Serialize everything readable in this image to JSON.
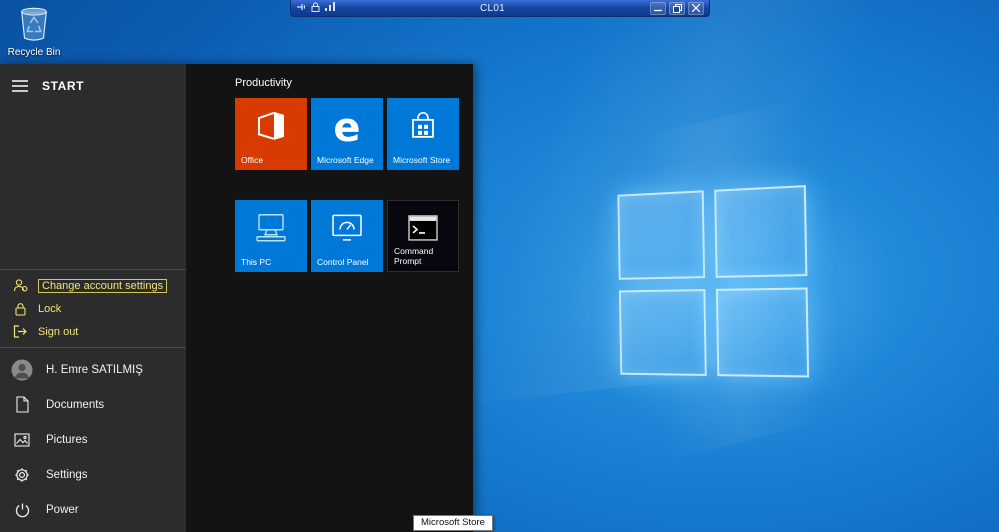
{
  "connection_bar": {
    "title": "CL01"
  },
  "desktop": {
    "recycle_bin": {
      "label": "Recycle Bin"
    }
  },
  "start_menu": {
    "header": "START",
    "account_menu": {
      "items": [
        {
          "label": "Change account settings",
          "icon": "account-settings-icon"
        },
        {
          "label": "Lock",
          "icon": "lock-icon"
        },
        {
          "label": "Sign out",
          "icon": "sign-out-icon"
        }
      ]
    },
    "nav": {
      "items": [
        {
          "label": "H. Emre SATILMIŞ",
          "icon": "user-avatar"
        },
        {
          "label": "Documents",
          "icon": "documents-icon"
        },
        {
          "label": "Pictures",
          "icon": "pictures-icon"
        },
        {
          "label": "Settings",
          "icon": "settings-icon"
        },
        {
          "label": "Power",
          "icon": "power-icon"
        }
      ]
    },
    "tiles": {
      "group_label": "Productivity",
      "items": [
        {
          "label": "Office",
          "icon": "office-icon",
          "color": "#d83b01"
        },
        {
          "label": "Microsoft Edge",
          "icon": "edge-icon",
          "glyph": "e",
          "color": "#0078d7"
        },
        {
          "label": "Microsoft Store",
          "icon": "store-icon",
          "color": "#0078d7"
        },
        {
          "label": "This PC",
          "icon": "this-pc-icon",
          "color": "#0078d7"
        },
        {
          "label": "Control Panel",
          "icon": "control-panel-icon",
          "color": "#0078d7"
        },
        {
          "label": "Command Prompt",
          "icon": "command-prompt-icon",
          "color": "#07070f"
        }
      ]
    }
  },
  "tooltip": {
    "text": "Microsoft Store"
  },
  "colors": {
    "accent_blue": "#0078d7",
    "office_orange": "#d83b01",
    "focus_yellow": "#efe673",
    "rail_bg": "#2c2c2c",
    "tiles_bg": "#131313",
    "connection_bar_blue": "#16479f",
    "wallpaper_blue": "#1478cd"
  }
}
